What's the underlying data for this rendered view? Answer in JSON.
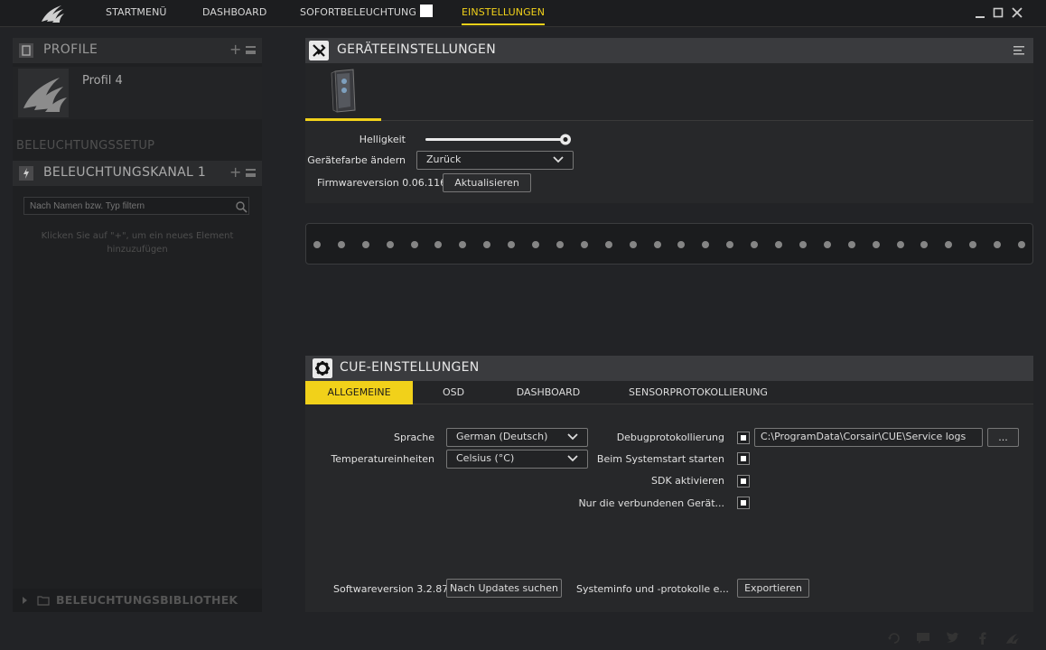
{
  "nav": {
    "items": [
      "STARTMENÜ",
      "DASHBOARD",
      "SOFORTBELEUCHTUNG",
      "EINSTELLUNGEN"
    ]
  },
  "left": {
    "profile_header": "PROFILE",
    "profile_name": "Profil 4",
    "lighting_setup": "BELEUCHTUNGSSETUP",
    "channel_header": "BELEUCHTUNGSKANAL 1",
    "filter_placeholder": "Nach Namen bzw. Typ filtern",
    "hint": "Klicken Sie auf \"+\", um ein neues Element hinzuzufügen",
    "library": "BELEUCHTUNGSBIBLIOTHEK"
  },
  "device": {
    "title": "GERÄTEEINSTELLUNGEN",
    "brightness_label": "Helligkeit",
    "brightness": 1.0,
    "color_label": "Gerätefarbe ändern",
    "color_value": "Zurück",
    "firmware_label": "Firmwareversion 0.06.116",
    "update_button": "Aktualisieren",
    "led_count": 30
  },
  "cue": {
    "title": "CUE-EINSTELLUNGEN",
    "tabs": [
      "ALLGEMEINE",
      "OSD",
      "DASHBOARD",
      "SENSORPROTOKOLLIERUNG"
    ],
    "language_label": "Sprache",
    "language_value": "German (Deutsch)",
    "temp_label": "Temperatureinheiten",
    "temp_value": "Celsius (°C)",
    "debug_label": "Debugprotokollierung",
    "debug_path": "C:\\ProgramData\\Corsair\\CUE\\Service logs",
    "browse_button": "...",
    "startup_label": "Beim Systemstart starten",
    "sdk_label": "SDK aktivieren",
    "connected_label": "Nur die verbundenen Gerät...",
    "software_label": "Softwareversion 3.2.87",
    "check_updates_button": "Nach Updates suchen",
    "sysinfo_label": "Systeminfo und -protokolle e...",
    "export_button": "Exportieren"
  },
  "colors": {
    "accent": "#f1d11a"
  }
}
